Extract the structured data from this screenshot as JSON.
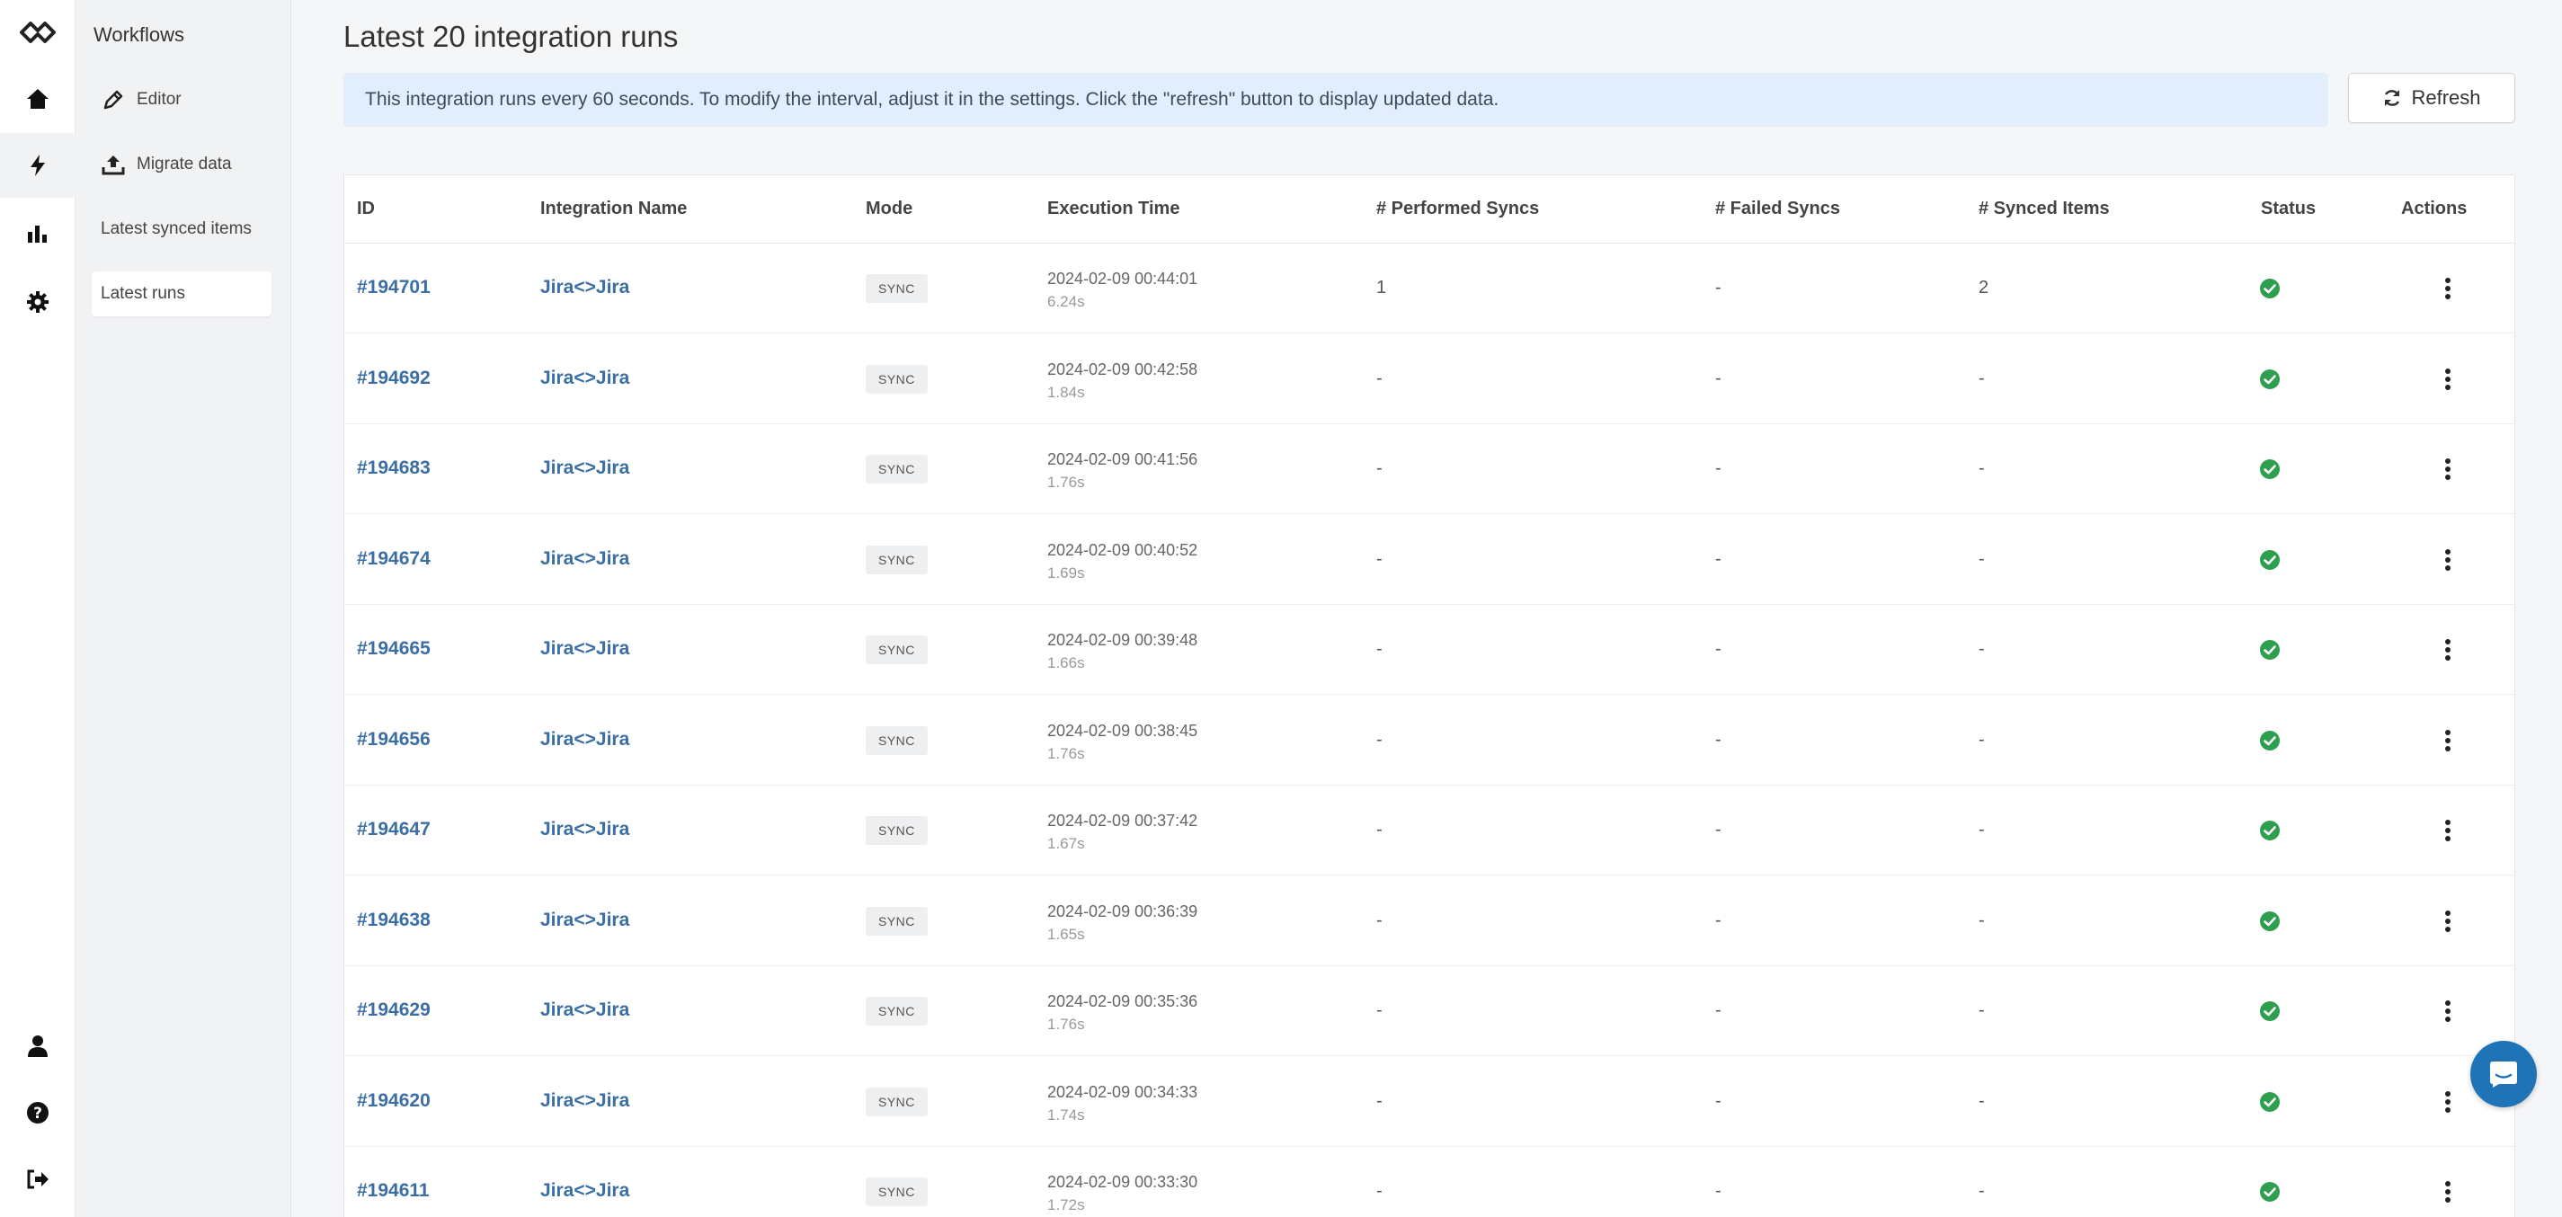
{
  "rail": {
    "items": [
      {
        "icon": "logo-icon"
      },
      {
        "icon": "home-icon"
      },
      {
        "icon": "bolt-icon"
      },
      {
        "icon": "bar-chart-icon"
      },
      {
        "icon": "gear-icon"
      },
      {
        "icon": "user-icon"
      },
      {
        "icon": "help-icon"
      },
      {
        "icon": "logout-icon"
      }
    ]
  },
  "subnav": {
    "title": "Workflows",
    "items": [
      {
        "label": "Editor",
        "icon": "pencil-icon"
      },
      {
        "label": "Migrate data",
        "icon": "upload-icon"
      },
      {
        "label": "Latest synced items"
      },
      {
        "label": "Latest runs"
      }
    ]
  },
  "page": {
    "title": "Latest 20 integration runs",
    "banner": "This integration runs every 60 seconds. To modify the interval, adjust it in the settings. Click the \"refresh\" button to display updated data.",
    "refresh_label": "Refresh"
  },
  "table": {
    "headers": [
      "ID",
      "Integration Name",
      "Mode",
      "Execution Time",
      "# Performed Syncs",
      "# Failed Syncs",
      "# Synced Items",
      "Status",
      "Actions"
    ],
    "rows": [
      {
        "id": "#194701",
        "name": "Jira<>Jira",
        "mode": "SYNC",
        "time": "2024-02-09 00:44:01",
        "duration": "6.24s",
        "performed": "1",
        "failed": "-",
        "items": "2",
        "status": "success"
      },
      {
        "id": "#194692",
        "name": "Jira<>Jira",
        "mode": "SYNC",
        "time": "2024-02-09 00:42:58",
        "duration": "1.84s",
        "performed": "-",
        "failed": "-",
        "items": "-",
        "status": "success"
      },
      {
        "id": "#194683",
        "name": "Jira<>Jira",
        "mode": "SYNC",
        "time": "2024-02-09 00:41:56",
        "duration": "1.76s",
        "performed": "-",
        "failed": "-",
        "items": "-",
        "status": "success"
      },
      {
        "id": "#194674",
        "name": "Jira<>Jira",
        "mode": "SYNC",
        "time": "2024-02-09 00:40:52",
        "duration": "1.69s",
        "performed": "-",
        "failed": "-",
        "items": "-",
        "status": "success"
      },
      {
        "id": "#194665",
        "name": "Jira<>Jira",
        "mode": "SYNC",
        "time": "2024-02-09 00:39:48",
        "duration": "1.66s",
        "performed": "-",
        "failed": "-",
        "items": "-",
        "status": "success"
      },
      {
        "id": "#194656",
        "name": "Jira<>Jira",
        "mode": "SYNC",
        "time": "2024-02-09 00:38:45",
        "duration": "1.76s",
        "performed": "-",
        "failed": "-",
        "items": "-",
        "status": "success"
      },
      {
        "id": "#194647",
        "name": "Jira<>Jira",
        "mode": "SYNC",
        "time": "2024-02-09 00:37:42",
        "duration": "1.67s",
        "performed": "-",
        "failed": "-",
        "items": "-",
        "status": "success"
      },
      {
        "id": "#194638",
        "name": "Jira<>Jira",
        "mode": "SYNC",
        "time": "2024-02-09 00:36:39",
        "duration": "1.65s",
        "performed": "-",
        "failed": "-",
        "items": "-",
        "status": "success"
      },
      {
        "id": "#194629",
        "name": "Jira<>Jira",
        "mode": "SYNC",
        "time": "2024-02-09 00:35:36",
        "duration": "1.76s",
        "performed": "-",
        "failed": "-",
        "items": "-",
        "status": "success"
      },
      {
        "id": "#194620",
        "name": "Jira<>Jira",
        "mode": "SYNC",
        "time": "2024-02-09 00:34:33",
        "duration": "1.74s",
        "performed": "-",
        "failed": "-",
        "items": "-",
        "status": "success"
      },
      {
        "id": "#194611",
        "name": "Jira<>Jira",
        "mode": "SYNC",
        "time": "2024-02-09 00:33:30",
        "duration": "1.72s",
        "performed": "-",
        "failed": "-",
        "items": "-",
        "status": "success"
      }
    ]
  },
  "colors": {
    "link": "#3a6ea5",
    "success": "#2e9e4f",
    "banner_bg": "#e3eefc",
    "chat": "#1f73b7"
  },
  "chat": {
    "icon": "chat-icon"
  }
}
